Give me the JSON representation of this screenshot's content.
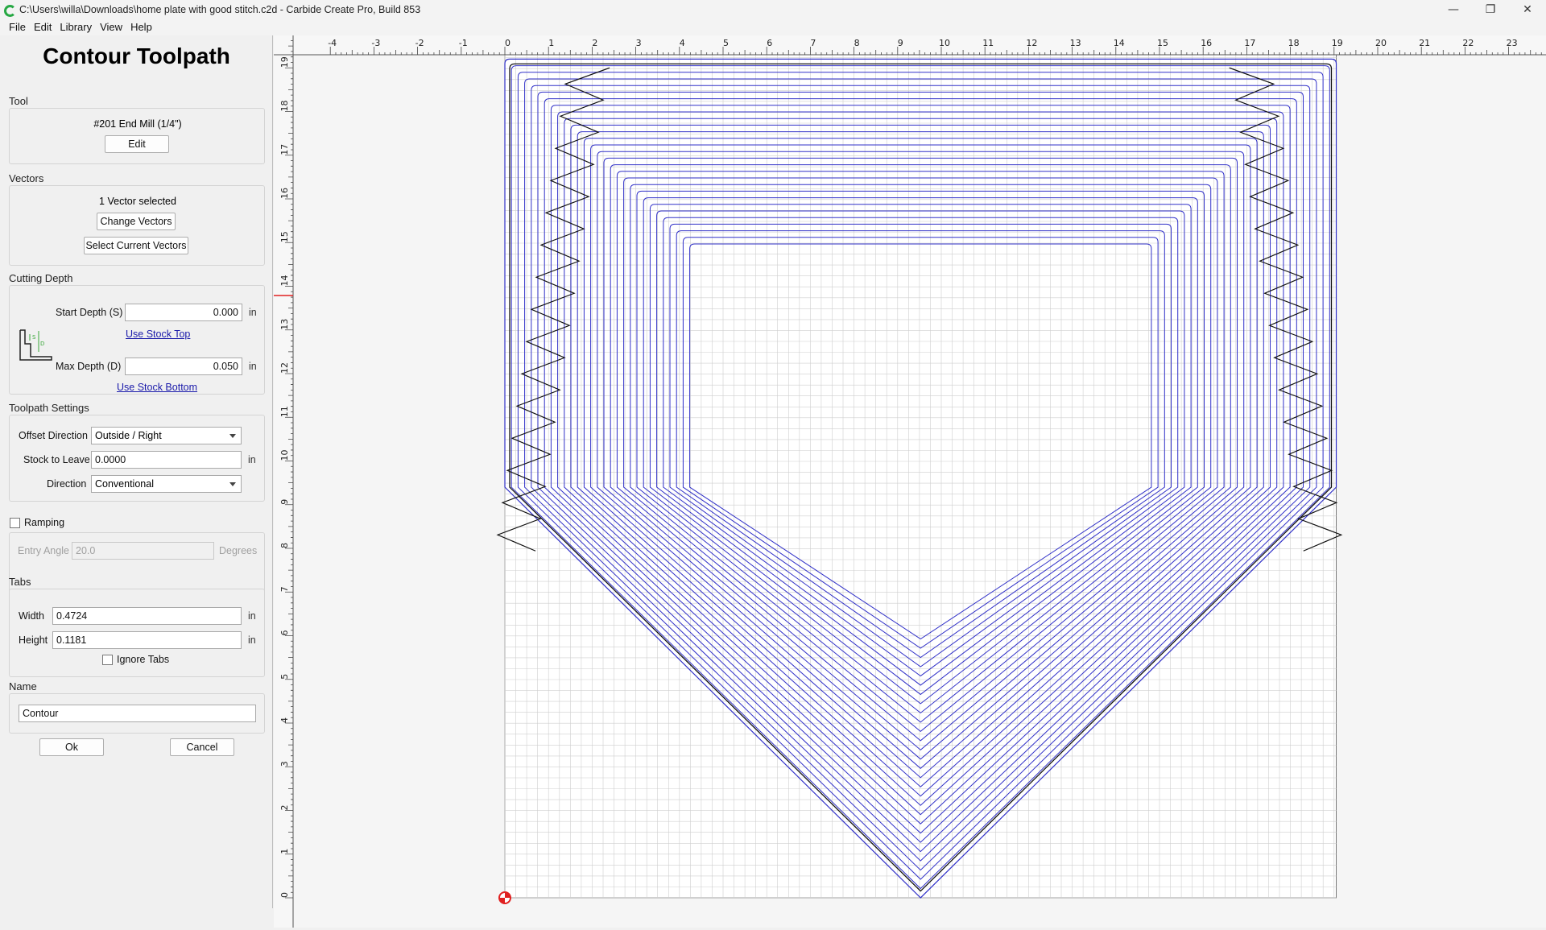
{
  "window": {
    "title": "C:\\Users\\willa\\Downloads\\home plate with good stitch.c2d - Carbide Create Pro, Build 853",
    "controls": {
      "minimize": "—",
      "restore": "❐",
      "close": "✕"
    }
  },
  "menu": {
    "items": [
      "File",
      "Edit",
      "Library",
      "View",
      "Help"
    ]
  },
  "panel": {
    "title": "Contour Toolpath",
    "tool": {
      "label": "Tool",
      "name": "#201 End Mill (1/4\")",
      "edit_button": "Edit"
    },
    "vectors": {
      "label": "Vectors",
      "status": "1 Vector selected",
      "change_button": "Change Vectors",
      "select_button": "Select Current Vectors"
    },
    "cutting_depth": {
      "label": "Cutting Depth",
      "start_label": "Start Depth (S)",
      "start_value": "0.000",
      "start_unit": "in",
      "use_top": "Use Stock Top",
      "max_label": "Max Depth (D)",
      "max_value": "0.050",
      "max_unit": "in",
      "use_bottom": "Use Stock Bottom"
    },
    "settings": {
      "label": "Toolpath Settings",
      "offset_label": "Offset Direction",
      "offset_value": "Outside / Right",
      "stock_label": "Stock to Leave",
      "stock_value": "0.0000",
      "stock_unit": "in",
      "direction_label": "Direction",
      "direction_value": "Conventional"
    },
    "ramping": {
      "label": "Ramping",
      "checked": false,
      "angle_label": "Entry Angle",
      "angle_value": "20.0",
      "angle_unit": "Degrees"
    },
    "tabs": {
      "label": "Tabs",
      "width_label": "Width",
      "width_value": "0.4724",
      "width_unit": "in",
      "height_label": "Height",
      "height_value": "0.1181",
      "height_unit": "in",
      "ignore_label": "Ignore Tabs"
    },
    "name": {
      "label": "Name",
      "value": "Contour"
    },
    "ok_button": "Ok",
    "cancel_button": "Cancel"
  },
  "canvas": {
    "ruler_x_labels": [
      "-4",
      "-3",
      "-2",
      "-1",
      "0",
      "1",
      "2",
      "3",
      "4",
      "5",
      "6",
      "7",
      "8",
      "9",
      "10",
      "11",
      "12",
      "13",
      "14",
      "15",
      "16",
      "17",
      "18",
      "19",
      "20",
      "21",
      "22",
      "23"
    ],
    "ruler_y_labels": [
      "0",
      "1",
      "2",
      "3",
      "4",
      "5",
      "6",
      "7",
      "8",
      "9",
      "10",
      "11",
      "12",
      "13",
      "14",
      "15",
      "16",
      "17",
      "18",
      "19"
    ],
    "colors": {
      "toolpath": "#3030c8",
      "outline": "#111111",
      "grid": "#cfcfcf",
      "origin": "#e02020"
    }
  }
}
